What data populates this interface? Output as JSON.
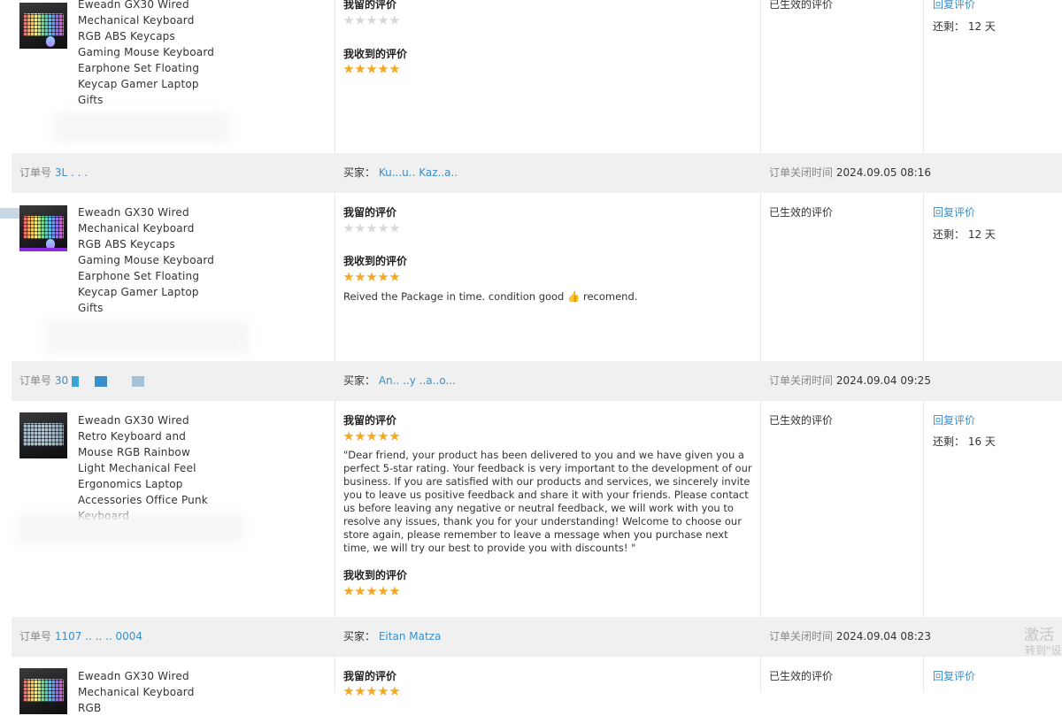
{
  "labels": {
    "my_review": "我留的评价",
    "received_review": "我收到的评价",
    "order_no": "订单号",
    "buyer": "买家：",
    "close_time": "订单关闭时间",
    "status": "已生效的评价",
    "reply": "回复评价",
    "remaining": "还剩：",
    "reply_top_partial": "回复评价",
    "status_top_partial": "已生效的评价"
  },
  "orders": [
    {
      "product": "Eweadn GX30 Wired Mechanical Keyboard RGB ABS Keycaps Gaming Mouse Keyboard Earphone Set Floating Keycap Gamer Laptop Gifts",
      "my_rating": 0,
      "received_rating": 5,
      "remaining": "12 天"
    },
    {
      "order_no_visible": "3L  .  .  .      1875",
      "buyer": "Ku...u.. Kaz..a..",
      "close_time": "2024.09.05 08:16",
      "product": "Eweadn GX30 Wired Mechanical Keyboard RGB ABS Keycaps Gaming Mouse Keyboard Earphone Set Floating Keycap Gamer Laptop Gifts",
      "my_rating": 0,
      "received_rating": 5,
      "received_text": "Reived the Package in time. condition good 👍 recomend.",
      "remaining": "12 天"
    },
    {
      "order_no_visible": "30",
      "buyer": "An.. ..y ..a..o...",
      "close_time": "2024.09.04 09:25",
      "product": "Eweadn GX30 Wired Retro Keyboard and Mouse RGB Rainbow Light Mechanical Feel Ergonomics Laptop Accessories Office Punk Keyboard",
      "my_rating": 5,
      "my_text": "\"Dear friend, your product has been delivered to you and we have given you a perfect 5-star rating. Your feedback is very important to the development of our business. If you are satisfied with our products and services, we sincerely invite you to leave us positive feedback and share it with your friends. Please contact us before leaving any negative or neutral feedback, we will work with you to resolve any issues, thank you for your understanding! Welcome to choose our store again, please remember to leave a message when you purchase next time, we will try our best to provide you with discounts! \"",
      "received_rating": 5,
      "remaining": "16 天"
    },
    {
      "order_no_visible": "1107 .. ..   .. 0004",
      "buyer": "Eitan Matza",
      "close_time": "2024.09.04 08:23",
      "product": "Eweadn GX30 Wired Mechanical Keyboard RGB",
      "my_rating": 5
    }
  ],
  "watermark": {
    "line1": "激活",
    "line2": "转到\"设"
  },
  "colors": {
    "link": "#3a8fc9",
    "star_on": "#f5a623",
    "star_off": "#d9d9d9",
    "header_bg": "#f0f0f0"
  }
}
